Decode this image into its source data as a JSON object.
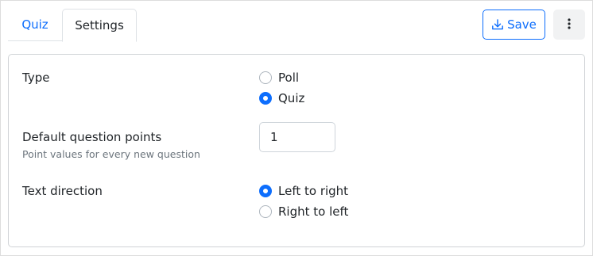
{
  "tabs": [
    {
      "label": "Quiz",
      "active": false
    },
    {
      "label": "Settings",
      "active": true
    }
  ],
  "toolbar": {
    "save_label": "Save",
    "save_icon": "download-icon",
    "more_icon": "vertical-dots-icon"
  },
  "settings": {
    "type": {
      "label": "Type",
      "options": [
        {
          "label": "Poll",
          "checked": false
        },
        {
          "label": "Quiz",
          "checked": true
        }
      ]
    },
    "points": {
      "label": "Default question points",
      "help": "Point values for every new question",
      "value": "1"
    },
    "direction": {
      "label": "Text direction",
      "options": [
        {
          "label": "Left to right",
          "checked": true
        },
        {
          "label": "Right to left",
          "checked": false
        }
      ]
    }
  },
  "colors": {
    "accent": "#0d6efd",
    "muted_text": "#6c757d",
    "border": "#dee2e6"
  }
}
